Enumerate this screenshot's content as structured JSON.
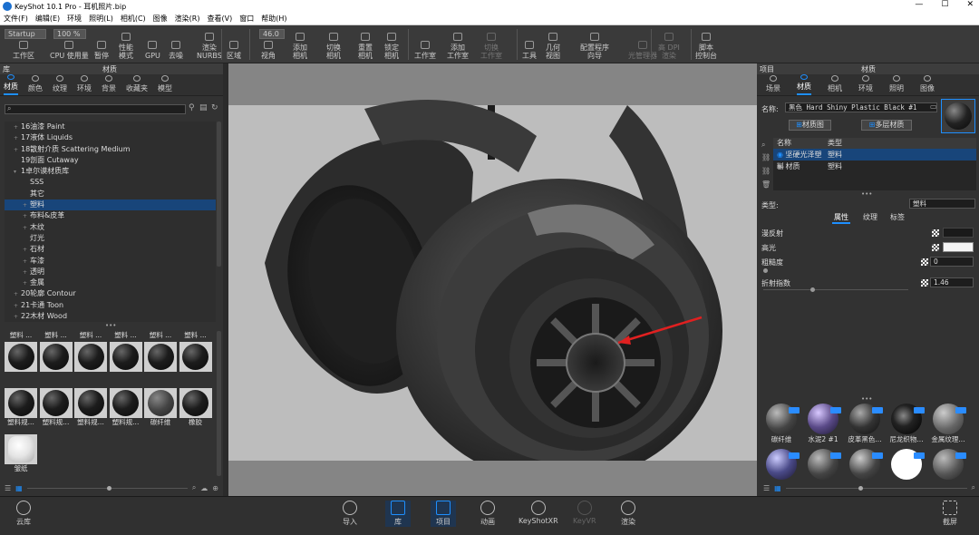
{
  "window": {
    "title": "KeyShot 10.1 Pro - 耳机照片.bip",
    "controls": [
      "—",
      "☐",
      "✕"
    ]
  },
  "menu": [
    "文件(F)",
    "编辑(E)",
    "环境",
    "照明(L)",
    "相机(C)",
    "图像",
    "渲染(R)",
    "查看(V)",
    "窗口",
    "帮助(H)"
  ],
  "toolbar": {
    "workspace_select": "Startup",
    "cpu_percent": "100 %",
    "fov_value": "46.0",
    "items": [
      "工作区",
      "CPU 使用量",
      "暂停",
      "性能\n模式",
      "GPU",
      "去噪",
      "渲染\nNURBS",
      "区域",
      "视角",
      "添加\n相机",
      "切换\n相机",
      "重置\n相机",
      "锁定\n相机",
      "工作室",
      "添加\n工作室",
      "切换\n工作室",
      "工具",
      "几何\n视图",
      "配置程序\n向导",
      "光管理器",
      "高 DPI\n渲染",
      "脚本\n控制台"
    ]
  },
  "library": {
    "panel_label": "库",
    "header": "材质",
    "tabs": [
      "材质",
      "颜色",
      "纹理",
      "环境",
      "背景",
      "收藏夹",
      "模型"
    ],
    "tree": [
      {
        "label": "16油漆 Paint",
        "indent": 1,
        "arrow": "+"
      },
      {
        "label": "17液体 Liquids",
        "indent": 1,
        "arrow": "+"
      },
      {
        "label": "18散射介质 Scattering Medium",
        "indent": 1,
        "arrow": "+"
      },
      {
        "label": "19剖面 Cutaway",
        "indent": 1,
        "arrow": ""
      },
      {
        "label": "1卓尔谟材质库",
        "indent": 1,
        "arrow": "▾"
      },
      {
        "label": "SSS",
        "indent": 2,
        "arrow": ""
      },
      {
        "label": "其它",
        "indent": 2,
        "arrow": ""
      },
      {
        "label": "塑料",
        "indent": 2,
        "arrow": "+",
        "selected": true
      },
      {
        "label": "布料&皮革",
        "indent": 2,
        "arrow": "+"
      },
      {
        "label": "木纹",
        "indent": 2,
        "arrow": "+"
      },
      {
        "label": "灯光",
        "indent": 2,
        "arrow": ""
      },
      {
        "label": "石材",
        "indent": 2,
        "arrow": "+"
      },
      {
        "label": "车漆",
        "indent": 2,
        "arrow": "+"
      },
      {
        "label": "透明",
        "indent": 2,
        "arrow": "+"
      },
      {
        "label": "金属",
        "indent": 2,
        "arrow": "+"
      },
      {
        "label": "20轮廓 Contour",
        "indent": 1,
        "arrow": "+"
      },
      {
        "label": "21卡通 Toon",
        "indent": 1,
        "arrow": "+"
      },
      {
        "label": "22木材 Wood",
        "indent": 1,
        "arrow": "+"
      }
    ],
    "thumbs_top_labels": [
      "塑料 ...",
      "塑料 ...",
      "塑料 ...",
      "塑料 ...",
      "塑料 ...",
      "塑料 ..."
    ],
    "thumbs": [
      {
        "label": "",
        "kind": "plastic"
      },
      {
        "label": "",
        "kind": "plastic"
      },
      {
        "label": "",
        "kind": "plastic"
      },
      {
        "label": "",
        "kind": "plastic"
      },
      {
        "label": "",
        "kind": "plastic"
      },
      {
        "label": "",
        "kind": "plastic"
      },
      {
        "label": "塑料规...",
        "kind": "plastic"
      },
      {
        "label": "塑料规...",
        "kind": "plastic"
      },
      {
        "label": "塑料规...",
        "kind": "plastic"
      },
      {
        "label": "塑料规...",
        "kind": "plastic"
      },
      {
        "label": "碳纤维",
        "kind": "fiber"
      },
      {
        "label": "橡胶",
        "kind": "plastic"
      },
      {
        "label": "皱纸",
        "kind": "paper"
      }
    ]
  },
  "project": {
    "panel_label": "项目",
    "header": "材质",
    "tabs": [
      "场景",
      "材质",
      "相机",
      "环境",
      "照明",
      "图像"
    ],
    "name_label": "名称:",
    "name_value": "黑色 Hard Shiny Plastic Black #1",
    "btn_material_graph": "材质图",
    "btn_multi_layer": "多层材质",
    "cols": [
      "名称",
      "类型"
    ],
    "rows": [
      {
        "name": "坚硬光泽塑料",
        "type": "塑料",
        "selected": true
      },
      {
        "name": "材质",
        "type": "塑料"
      }
    ],
    "type_label": "类型:",
    "type_value": "塑料",
    "subtabs": [
      "属性",
      "纹理",
      "标签"
    ],
    "props": [
      {
        "label": "漫反射",
        "value": ""
      },
      {
        "label": "高光",
        "value": ""
      },
      {
        "label": "粗糙度",
        "value": "0"
      },
      {
        "label": "折射指数",
        "value": "1.46"
      }
    ],
    "balls": [
      {
        "label": "碳纤维"
      },
      {
        "label": "水泥2 #1"
      },
      {
        "label": "皮革黑色..."
      },
      {
        "label": "尼龙织物..."
      },
      {
        "label": "金属纹理..."
      },
      {
        "label": ""
      },
      {
        "label": ""
      },
      {
        "label": ""
      },
      {
        "label": ""
      },
      {
        "label": ""
      }
    ]
  },
  "bottom": {
    "cloud": "云库",
    "items": [
      "导入",
      "库",
      "项目",
      "动画",
      "KeyShotXR",
      "KeyVR",
      "渲染"
    ],
    "screenshot": "截屏"
  },
  "colors": {
    "accent": "#1e8fff",
    "selection": "#18457a",
    "arrow": "#e02020"
  }
}
